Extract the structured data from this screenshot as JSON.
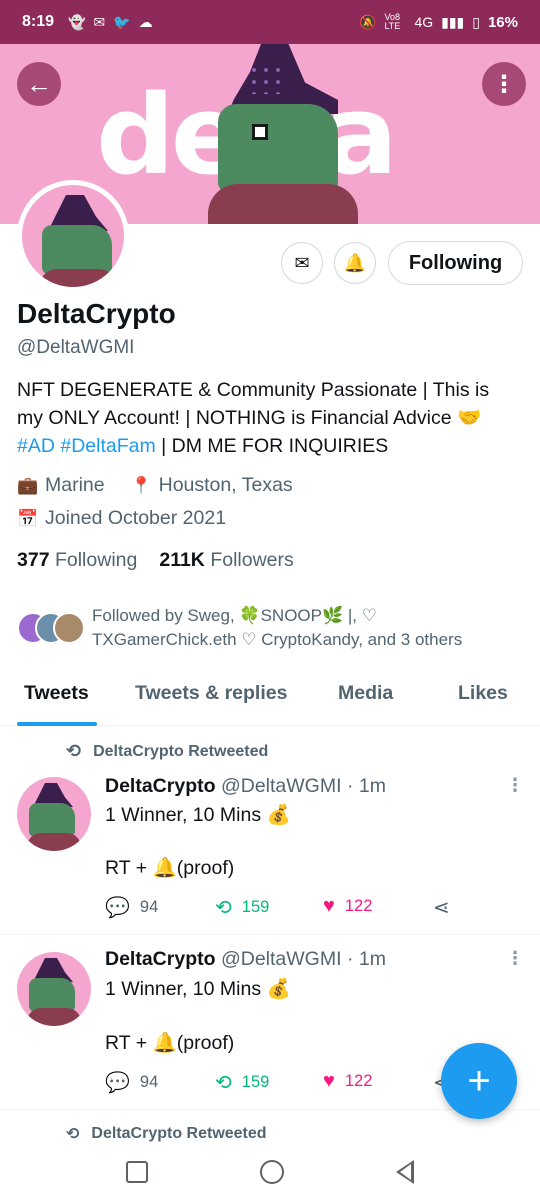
{
  "status_bar": {
    "time": "8:19",
    "network": "4G",
    "volte": "Vo8 LTE",
    "battery": "16%"
  },
  "banner": {
    "word": "delta"
  },
  "profile": {
    "name": "DeltaCrypto",
    "handle": "@DeltaWGMI",
    "bio_main": "NFT DEGENERATE & Community Passionate | This is my ONLY Account! | NOTHING is Financial Advice 🤝",
    "bio_tag1": "#AD",
    "bio_tag2": "#DeltaFam",
    "bio_end": "| DM ME FOR INQUIRIES",
    "work": "Marine",
    "location": "Houston, Texas",
    "joined": "Joined October 2021",
    "following_count": "377",
    "following_label": "Following",
    "followers_count": "211K",
    "followers_label": "Followers",
    "followed_by": "Followed by Sweg, 🍀SNOOP🌿 |, ♡ TXGamerChick.eth ♡ CryptoKandy, and 3 others",
    "follow_button": "Following"
  },
  "tabs": [
    {
      "label": "Tweets"
    },
    {
      "label": "Tweets & replies"
    },
    {
      "label": "Media"
    },
    {
      "label": "Likes"
    }
  ],
  "tweets": [
    {
      "retweeted_by": "DeltaCrypto Retweeted",
      "name": "DeltaCrypto",
      "handle": "@DeltaWGMI",
      "time": "· 1m",
      "line1": "1 Winner, 10 Mins 💰",
      "line2": "RT + 🔔(proof)",
      "replies": "94",
      "retweets": "159",
      "likes": "122"
    },
    {
      "retweeted_by": "DeltaCrypto Retweeted",
      "name": "DeltaCrypto",
      "handle": "@DeltaWGMI",
      "time": "· 1m",
      "line1": "1 Winner, 10 Mins 💰",
      "line2": "RT + 🔔(proof)",
      "replies": "94",
      "retweets": "159",
      "likes": "122"
    }
  ],
  "next_retweet": "DeltaCrypto Retweeted",
  "colors": {
    "status_bar": "#8e2a5a",
    "banner": "#f4a6cf",
    "accent": "#1d9bf0",
    "retweet": "#00ba7c",
    "like": "#f91880"
  },
  "icons": {
    "back": "arrow-left-icon",
    "more": "more-vertical-icon",
    "mail": "mail-icon",
    "bell": "bell-plus-icon",
    "compose": "plus-icon"
  }
}
